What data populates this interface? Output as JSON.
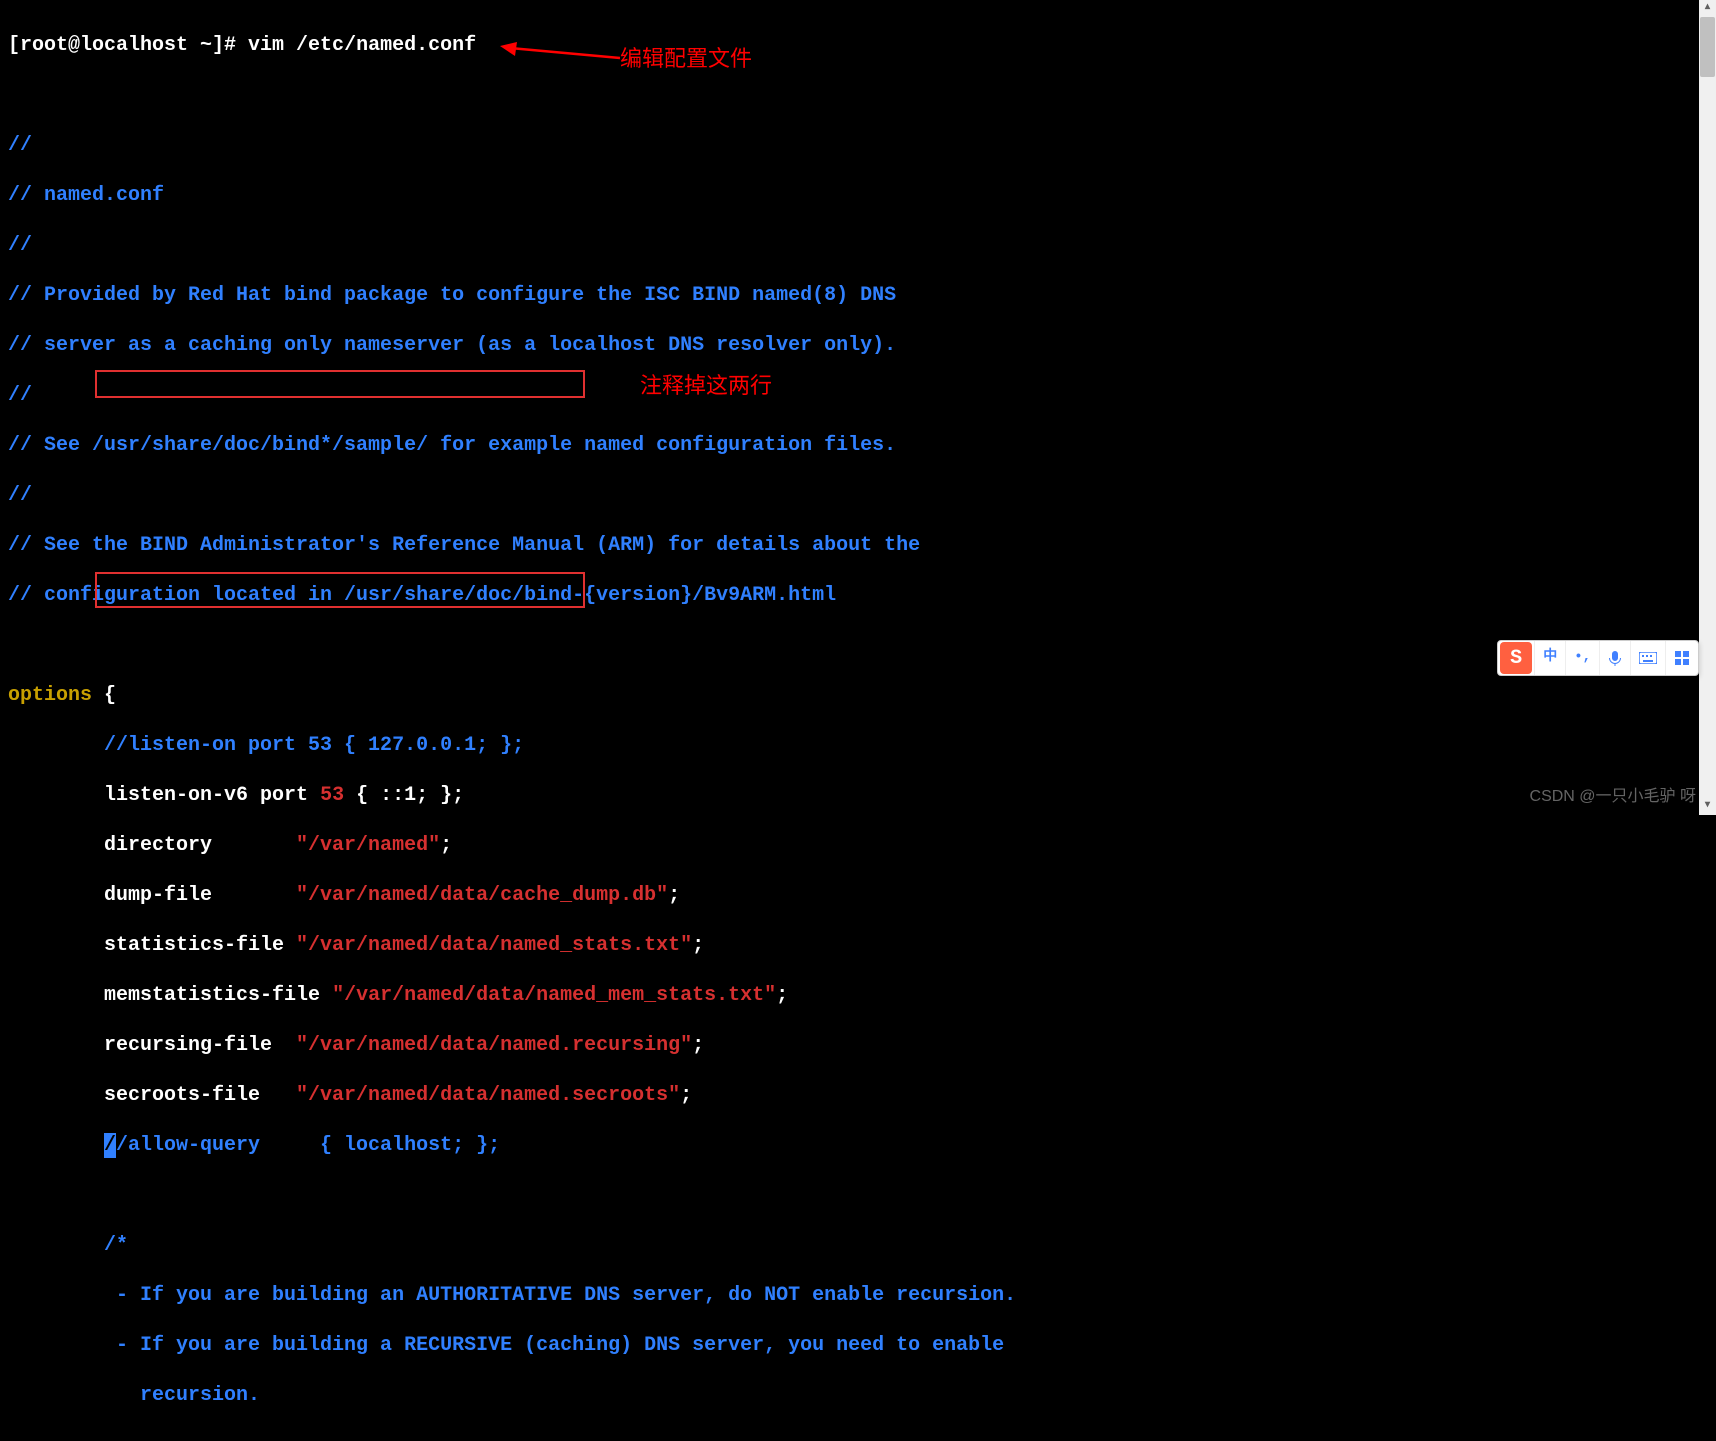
{
  "prompt": "[root@localhost ~]# ",
  "command": "vim /etc/named.conf",
  "annotations": {
    "edit_config": "编辑配置文件",
    "comment_lines": "注释掉这两行"
  },
  "comments": {
    "l1": "//",
    "l2": "// named.conf",
    "l3": "//",
    "l4": "// Provided by Red Hat bind package to configure the ISC BIND named(8) DNS",
    "l5": "// server as a caching only nameserver (as a localhost DNS resolver only).",
    "l6": "//",
    "l7": "// See /usr/share/doc/bind*/sample/ for example named configuration files.",
    "l8": "//",
    "l9": "// See the BIND Administrator's Reference Manual (ARM) for details about the",
    "l10": "// configuration located in /usr/share/doc/bind-{version}/Bv9ARM.html"
  },
  "config": {
    "options_keyword": "options",
    "brace_open": " {",
    "listen_on": "        //listen-on port 53 { 127.0.0.1; };",
    "listen_on_v6_pre": "        listen-on-v6 port ",
    "listen_on_v6_num": "53",
    "listen_on_v6_post": " { ::1; };",
    "directory_key": "        directory       ",
    "directory_val": "\"/var/named\"",
    "semicolon": ";",
    "dump_file_key": "        dump-file       ",
    "dump_file_val": "\"/var/named/data/cache_dump.db\"",
    "stats_file_key": "        statistics-file ",
    "stats_file_val": "\"/var/named/data/named_stats.txt\"",
    "memstats_key": "        memstatistics-file ",
    "memstats_val": "\"/var/named/data/named_mem_stats.txt\"",
    "recursing_key": "        recursing-file  ",
    "recursing_val": "\"/var/named/data/named.recursing\"",
    "secroots_key": "        secroots-file   ",
    "secroots_val": "\"/var/named/data/named.secroots\"",
    "allow_query_cursor": "/",
    "allow_query": "/allow-query     { localhost; };"
  },
  "block_comment": {
    "open": "        /*",
    "l1": "         - If you are building an AUTHORITATIVE DNS server, do NOT enable recursion.",
    "l2": "         - If you are building a RECURSIVE (caching) DNS server, you need to enable",
    "l3": "           recursion."
  },
  "watermark": "CSDN @一只小毛驴 呀",
  "ime": {
    "logo": "S",
    "lang": "中"
  }
}
